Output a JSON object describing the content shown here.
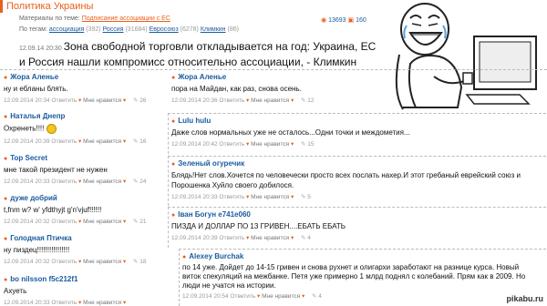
{
  "header": {
    "title": "Политика Украины",
    "materials_label": "Материалы по теме:",
    "materials_link": "Подписание ассоциации с ЕС",
    "views": "13693",
    "comments": "160",
    "tags_label": "По тегам:",
    "tags": [
      {
        "name": "ассоциация",
        "count": "(392)"
      },
      {
        "name": "Россия",
        "count": "(31684)"
      },
      {
        "name": "Евросоюз",
        "count": "(6278)"
      },
      {
        "name": "Климкин",
        "count": "(86)"
      }
    ]
  },
  "article": {
    "timestamp": "12.09.14 20:30",
    "headline_line1": "Зона свободной торговли откладывается на год: Украина, ЕС",
    "headline_line2": "и Россия нашли компромисс относительно ассоциации, - Климкин"
  },
  "footer_template": {
    "reply": "Ответить",
    "like": "Мне нравится"
  },
  "left_comments": [
    {
      "author": "Жора Аленье",
      "text": "ну и ебланы блять.",
      "time": "12.09.2014 20:34",
      "score": "26"
    },
    {
      "author": "Наталья Днепр",
      "text": "Охренеть!!!!",
      "time": "12.09.2014 20:39",
      "score": "16"
    },
    {
      "author": "Top Secret",
      "text": "мне такой президент не нужен",
      "time": "12.09.2014 20:33",
      "score": "24"
    },
    {
      "author": "дуже добрий",
      "text": "t,fnm w? w' yfdthyjt g'n'vjuf!!!!!!",
      "time": "12.09.2014 20:32",
      "score": "21"
    },
    {
      "author": "Голодная Птичка",
      "text": "ну пиздец!!!!!!!!!!!!!!!!",
      "time": "12.09.2014 20:32",
      "score": "18"
    },
    {
      "author": "bo nilsson f5c212f1",
      "text": "Ахуеть",
      "time": "12.09.2014 20:33",
      "score": ""
    }
  ],
  "right_comments": [
    {
      "author": "Жора Аленье",
      "text": "пора на Майдан, как раз, снова осень.",
      "time": "12.09.2014 20:36",
      "score": "12"
    },
    {
      "author": "Lulu hulu",
      "text": "Даже слов нормальных уже не осталось...Одни точки и междометия...",
      "time": "12.09.2014 20:42",
      "score": "15"
    },
    {
      "author": "Зеленый огуречик",
      "text": "Блядь!Нет слов.Хочется по человечески просто всех послать нахер.И этот гребаный еврейский союз и",
      "text2": "Порошенка Хуйло своего добилося.",
      "time": "12.09.2014 20:33",
      "score": "5"
    },
    {
      "author": "Іван Богун e741e060",
      "text": "ПИЗДА И ДОЛЛАР ПО 13 ГРИВЕН....ЕБАТЬ ЕБАТЬ",
      "time": "12.09.2014 20:39",
      "score": "4"
    },
    {
      "author": "Alexey Burchak",
      "text": "по 14 уже. Дойдет до 14-15 гривен и снова рухнет и олигархи заработают на разнице курса. Новый",
      "text2": "виток спекуляций на межбанке. Петя уже примерно 1 млрд поднял с колебаний. Прям как в 2009. Но",
      "text3": "люди не учатся на истории.",
      "time": "12.09.2014 20:54",
      "score": "4"
    }
  ],
  "watermark": "pikabu.ru"
}
